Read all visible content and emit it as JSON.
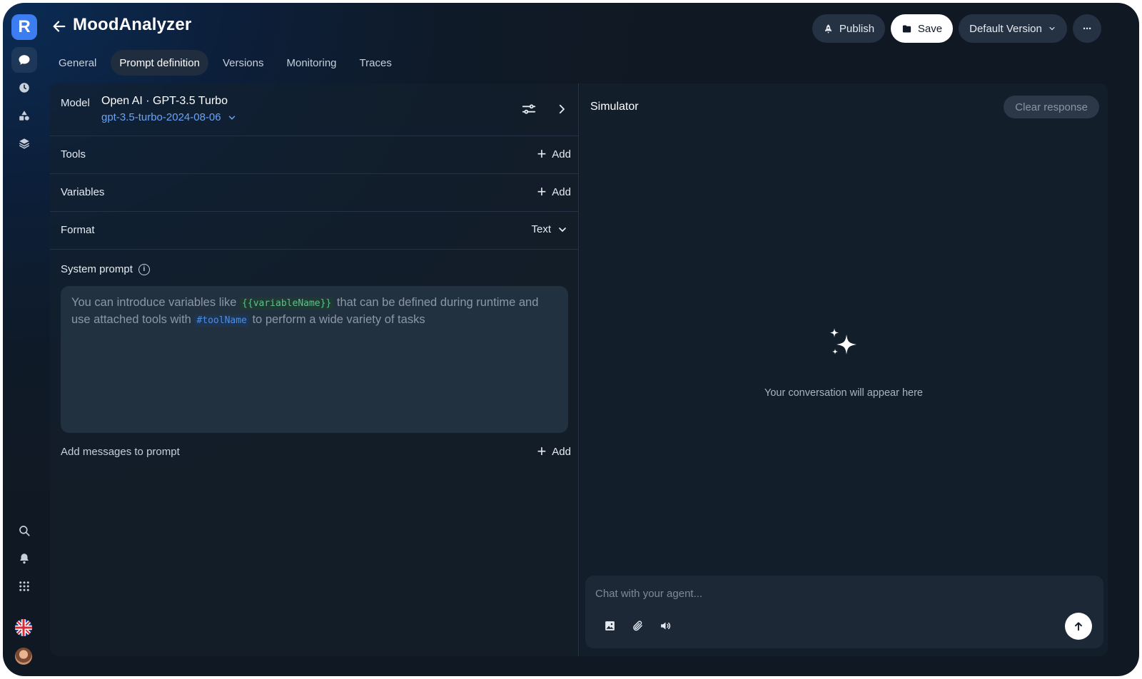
{
  "app": {
    "logo_letter": "R",
    "title": "MoodAnalyzer"
  },
  "rail": {
    "top_items": [
      {
        "name": "chat",
        "icon": "chat-bubble-icon"
      },
      {
        "name": "history",
        "icon": "clock-icon"
      },
      {
        "name": "components",
        "icon": "shapes-icon"
      },
      {
        "name": "layers",
        "icon": "layers-icon"
      }
    ],
    "bottom_items": [
      {
        "name": "search",
        "icon": "search-icon"
      },
      {
        "name": "notifications",
        "icon": "bell-icon"
      },
      {
        "name": "apps",
        "icon": "grid-icon"
      },
      {
        "name": "language",
        "icon": "uk-flag-icon"
      },
      {
        "name": "profile",
        "icon": "avatar"
      }
    ]
  },
  "header": {
    "publish_label": "Publish",
    "save_label": "Save",
    "version_label": "Default Version",
    "more_label": "···"
  },
  "tabs": [
    {
      "label": "General",
      "active": false
    },
    {
      "label": "Prompt definition",
      "active": true
    },
    {
      "label": "Versions",
      "active": false
    },
    {
      "label": "Monitoring",
      "active": false
    },
    {
      "label": "Traces",
      "active": false
    }
  ],
  "prompt_panel": {
    "model_label": "Model",
    "model_name": "Open AI · GPT-3.5 Turbo",
    "model_id": "gpt-3.5-turbo-2024-08-06",
    "tools_label": "Tools",
    "variables_label": "Variables",
    "format_label": "Format",
    "format_value": "Text",
    "add_label": "Add",
    "system_prompt_label": "System prompt",
    "system_prompt_placeholder": {
      "part1": "You can introduce variables like ",
      "variable_example": "{{variableName}}",
      "part2": " that can be defined during runtime and use attached tools with ",
      "tool_example": "#toolName",
      "part3": " to perform a wide variety of tasks"
    },
    "add_messages_label": "Add messages to prompt"
  },
  "simulator": {
    "title": "Simulator",
    "clear_label": "Clear response",
    "empty_text": "Your conversation will appear here",
    "chat_placeholder": "Chat with your agent..."
  },
  "colors": {
    "accent": "#3d7df2",
    "link": "#6aa3f5",
    "variable_chip": "#5fbf8f",
    "tool_chip": "#4f8fe0"
  }
}
